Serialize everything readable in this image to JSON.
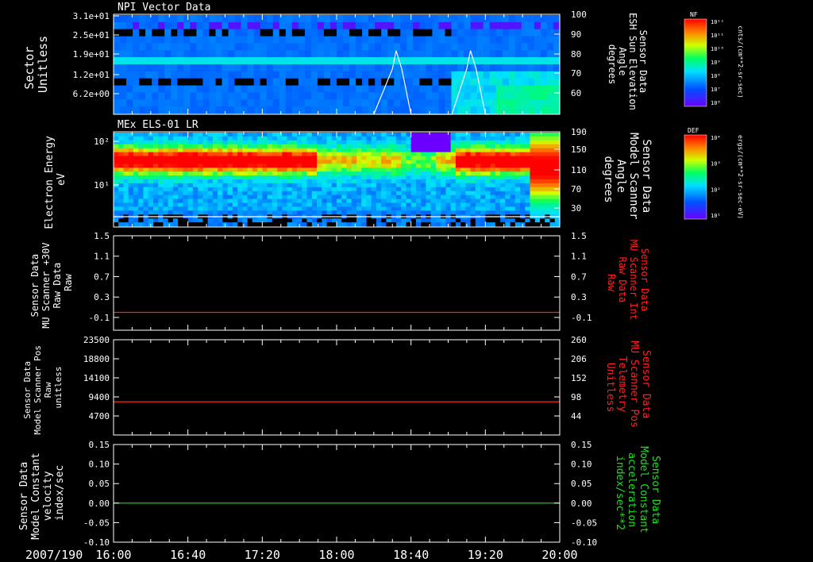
{
  "colors": {
    "background": "#000000",
    "axis": "#ffffff",
    "red_trace": "#ff2020",
    "green_trace": "#20e020",
    "white_trace": "#ffffff",
    "right_label_red": "#ff2020",
    "right_label_green": "#20e020"
  },
  "time_axis": {
    "date_label": "2007/190",
    "ticks": [
      "16:00",
      "16:40",
      "17:20",
      "18:00",
      "18:40",
      "19:20",
      "20:00"
    ]
  },
  "colorbars": [
    {
      "label": "NF",
      "scale": [
        "10¹²",
        "10¹¹",
        "10¹⁰",
        "10⁹",
        "10⁸",
        "10⁷",
        "10⁶"
      ],
      "units": "cnts/(cm**2-sr-sec)"
    },
    {
      "label": "DEF",
      "scale": [
        "10⁴",
        "10³",
        "10²",
        "10¹"
      ],
      "units": "ergs/(cm**2-sr-sec-eV)"
    }
  ],
  "chart_data": [
    {
      "type": "heatmap",
      "title": "NPI Vector Data",
      "ylabel": [
        "Sector",
        "Unitless"
      ],
      "yticks": [
        "3.1e+01",
        "2.5e+01",
        "1.9e+01",
        "1.2e+01",
        "6.2e+00"
      ],
      "y2label": [
        "Sensor Data",
        "ESH Sun Elevation",
        "Angle",
        "degrees"
      ],
      "y2ticks": [
        "100",
        "90",
        "80",
        "70",
        "60"
      ],
      "y2lim": [
        45,
        100
      ],
      "overlay": {
        "name": "ESH Sun Elevation",
        "color": "white",
        "x": [
          "18:20",
          "18:30",
          "18:32",
          "18:35",
          "18:40",
          "18:42",
          "19:02",
          "19:10",
          "19:12",
          "19:15",
          "19:20",
          "19:22"
        ],
        "y": [
          45,
          70,
          80,
          70,
          45,
          45,
          45,
          70,
          80,
          70,
          45,
          45
        ]
      }
    },
    {
      "type": "heatmap",
      "title": "MEx ELS-01 LR",
      "ylabel": [
        "Electron Energy",
        "eV"
      ],
      "yticks": [
        "10²",
        "10¹"
      ],
      "y2label": [
        "Sensor Data",
        "Model Scanner",
        "Angle",
        "degrees"
      ],
      "y2ticks": [
        "190",
        "150",
        "110",
        "70",
        "30"
      ],
      "overlay": {
        "name": "Model Scanner Angle",
        "color": "white",
        "value": 10
      }
    },
    {
      "type": "line",
      "ylabel": [
        "Sensor Data",
        "MU Scanner +30V",
        "Raw Data",
        "Raw"
      ],
      "yticks": [
        "1.5",
        "1.1",
        "0.7",
        "0.3",
        "-0.1"
      ],
      "ylim": [
        -0.35,
        1.5
      ],
      "y2label": [
        "Sensor Data",
        "MU Scanner Int",
        "Raw Data",
        "Raw"
      ],
      "y2ticks": [
        "1.5",
        "1.1",
        "0.7",
        "0.3",
        "-0.1"
      ],
      "series": [
        {
          "color": "red",
          "x": [
            "16:00",
            "20:00"
          ],
          "y": [
            0.0,
            0.0
          ]
        }
      ]
    },
    {
      "type": "line",
      "ylabel": [
        "Sensor Data",
        "Model Scanner Pos",
        "Raw",
        "unitless"
      ],
      "yticks": [
        "23500",
        "18800",
        "14100",
        "9400",
        "4700"
      ],
      "ylim": [
        0,
        23500
      ],
      "y2label": [
        "Sensor Data",
        "MU Scanner Pos",
        "Telemetry",
        "Unitless"
      ],
      "y2ticks": [
        "260",
        "206",
        "152",
        "98",
        "44"
      ],
      "series": [
        {
          "color": "red",
          "x": [
            "16:00",
            "20:00"
          ],
          "y": [
            8200,
            8200
          ]
        }
      ]
    },
    {
      "type": "line",
      "ylabel": [
        "Sensor Data",
        "Model Constant",
        "velocity",
        "index/sec"
      ],
      "yticks": [
        "0.15",
        "0.10",
        "0.05",
        "0.00",
        "-0.05",
        "-0.10"
      ],
      "ylim": [
        -0.1,
        0.15
      ],
      "y2label": [
        "Sensor Data",
        "Model Constant",
        "acceleration",
        "index/sec**2"
      ],
      "y2ticks": [
        "0.15",
        "0.10",
        "0.05",
        "0.00",
        "-0.05",
        "-0.10"
      ],
      "series": [
        {
          "color": "green",
          "x": [
            "16:00",
            "20:00"
          ],
          "y": [
            0.0,
            0.0
          ]
        }
      ]
    }
  ]
}
